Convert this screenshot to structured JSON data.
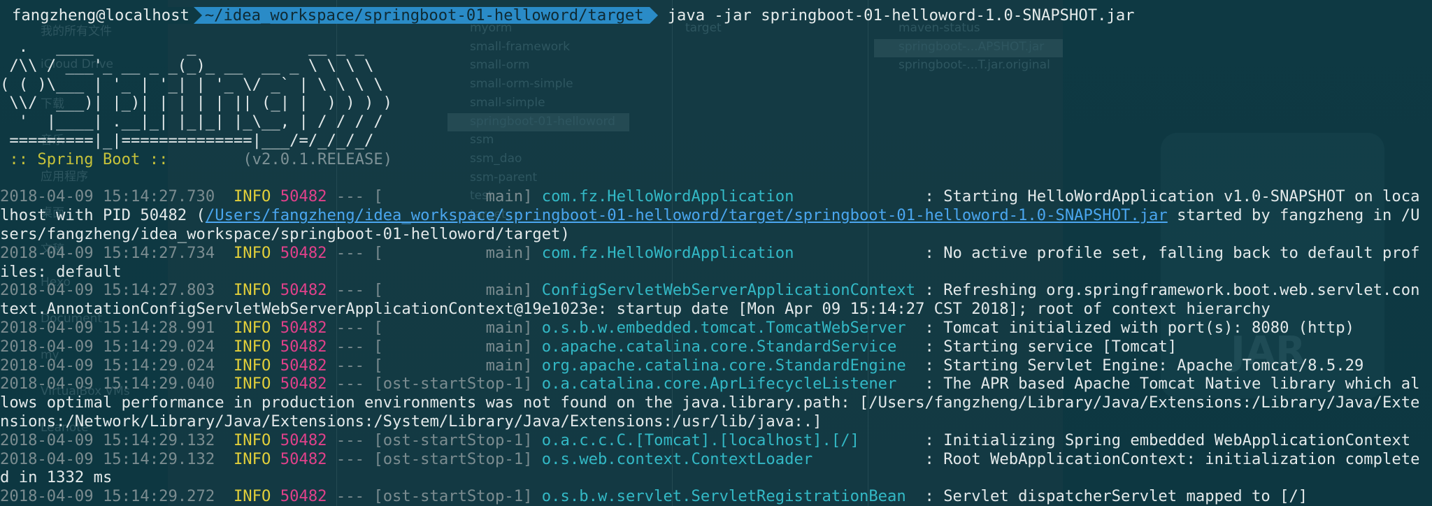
{
  "prompt": {
    "user": "fangzheng@localhost",
    "path": "~/idea_workspace/springboot-01-helloword/target",
    "command": "java -jar springboot-01-helloword-1.0-SNAPSHOT.jar"
  },
  "banner": [
    "  .   ____          _            __ _ _",
    " /\\\\ / ___'_ __ _ _(_)_ __  __ _ \\ \\ \\ \\",
    "( ( )\\___ | '_ | '_| | '_ \\/ _` | \\ \\ \\ \\",
    " \\\\/  ___)| |_)| | | | | || (_| |  ) ) ) )",
    "  '  |____| .__|_| |_|_| |_\\__, | / / / /",
    " =========|_|==============|___/=/_/_/_/"
  ],
  "spring_label": " :: Spring Boot :: ",
  "spring_version": "       (v2.0.1.RELEASE)",
  "log": [
    {
      "ts": "2018-04-09 15:14:27.730",
      "level": "INFO",
      "pid": "50482",
      "thread": "           main]",
      "logger": "com.fz.HelloWordApplication",
      "pad": "              ",
      "msg_a": ": Starting HelloWordApplication v1.0-SNAPSHOT on loca",
      "cont": [
        {
          "pre": "lhost with PID 50482 (",
          "link": "/Users/fangzheng/idea_workspace/springboot-01-helloword/target/springboot-01-helloword-1.0-SNAPSHOT.jar",
          "post": " started by fangzheng in /U"
        },
        {
          "pre": "sers/fangzheng/idea_workspace/springboot-01-helloword/target)",
          "link": "",
          "post": ""
        }
      ]
    },
    {
      "ts": "2018-04-09 15:14:27.734",
      "level": "INFO",
      "pid": "50482",
      "thread": "           main]",
      "logger": "com.fz.HelloWordApplication",
      "pad": "              ",
      "msg_a": ": No active profile set, falling back to default prof",
      "cont": [
        {
          "pre": "iles: default",
          "link": "",
          "post": ""
        }
      ]
    },
    {
      "ts": "2018-04-09 15:14:27.803",
      "level": "INFO",
      "pid": "50482",
      "thread": "           main]",
      "logger": "ConfigServletWebServerApplicationContext",
      "pad": " ",
      "msg_a": ": Refreshing org.springframework.boot.web.servlet.con",
      "cont": [
        {
          "pre": "text.AnnotationConfigServletWebServerApplicationContext@19e1023e: startup date [Mon Apr 09 15:14:27 CST 2018]; root of context hierarchy",
          "link": "",
          "post": ""
        }
      ]
    },
    {
      "ts": "2018-04-09 15:14:28.991",
      "level": "INFO",
      "pid": "50482",
      "thread": "           main]",
      "logger": "o.s.b.w.embedded.tomcat.TomcatWebServer",
      "pad": "  ",
      "msg_a": ": Tomcat initialized with port(s): 8080 (http)",
      "cont": []
    },
    {
      "ts": "2018-04-09 15:14:29.024",
      "level": "INFO",
      "pid": "50482",
      "thread": "           main]",
      "logger": "o.apache.catalina.core.StandardService",
      "pad": "   ",
      "msg_a": ": Starting service [Tomcat]",
      "cont": []
    },
    {
      "ts": "2018-04-09 15:14:29.024",
      "level": "INFO",
      "pid": "50482",
      "thread": "           main]",
      "logger": "org.apache.catalina.core.StandardEngine",
      "pad": "  ",
      "msg_a": ": Starting Servlet Engine: Apache Tomcat/8.5.29",
      "cont": []
    },
    {
      "ts": "2018-04-09 15:14:29.040",
      "level": "INFO",
      "pid": "50482",
      "thread": "ost-startStop-1]",
      "logger": "o.a.catalina.core.AprLifecycleListener",
      "pad": "   ",
      "msg_a": ": The APR based Apache Tomcat Native library which al",
      "cont": [
        {
          "pre": "lows optimal performance in production environments was not found on the java.library.path: [/Users/fangzheng/Library/Java/Extensions:/Library/Java/Exte",
          "link": "",
          "post": ""
        },
        {
          "pre": "nsions:/Network/Library/Java/Extensions:/System/Library/Java/Extensions:/usr/lib/java:.]",
          "link": "",
          "post": ""
        }
      ]
    },
    {
      "ts": "2018-04-09 15:14:29.132",
      "level": "INFO",
      "pid": "50482",
      "thread": "ost-startStop-1]",
      "logger": "o.a.c.c.C.[Tomcat].[localhost].[/]",
      "pad": "       ",
      "msg_a": ": Initializing Spring embedded WebApplicationContext",
      "cont": []
    },
    {
      "ts": "2018-04-09 15:14:29.132",
      "level": "INFO",
      "pid": "50482",
      "thread": "ost-startStop-1]",
      "logger": "o.s.web.context.ContextLoader",
      "pad": "            ",
      "msg_a": ": Root WebApplicationContext: initialization complete",
      "cont": [
        {
          "pre": "d in 1332 ms",
          "link": "",
          "post": ""
        }
      ]
    },
    {
      "ts": "2018-04-09 15:14:29.272",
      "level": "INFO",
      "pid": "50482",
      "thread": "ost-startStop-1]",
      "logger": "o.s.b.w.servlet.ServletRegistrationBean",
      "pad": "  ",
      "msg_a": ": Servlet dispatcherServlet mapped to [/]",
      "cont": []
    }
  ],
  "background_finder": {
    "col1": [
      "我的所有文件",
      "iCloud Drive",
      "下载",
      "音乐",
      "应用程序",
      "桌面",
      "文稿",
      "Hexo",
      "Document",
      "my",
      "VirtualBox VMs",
      "Leanote"
    ],
    "col2": [
      "myorm",
      "small-framework",
      "small-orm",
      "small-orm-simple",
      "small-simple",
      "springboot-01-helloword",
      "ssm",
      "ssm_dao",
      "ssm-parent",
      "test",
      "target"
    ],
    "col3": [
      "target"
    ],
    "col4": [
      "maven-status",
      "springboot-...APSHOT.jar",
      "springboot-...T.jar.original"
    ],
    "jar_label": "JAR"
  }
}
